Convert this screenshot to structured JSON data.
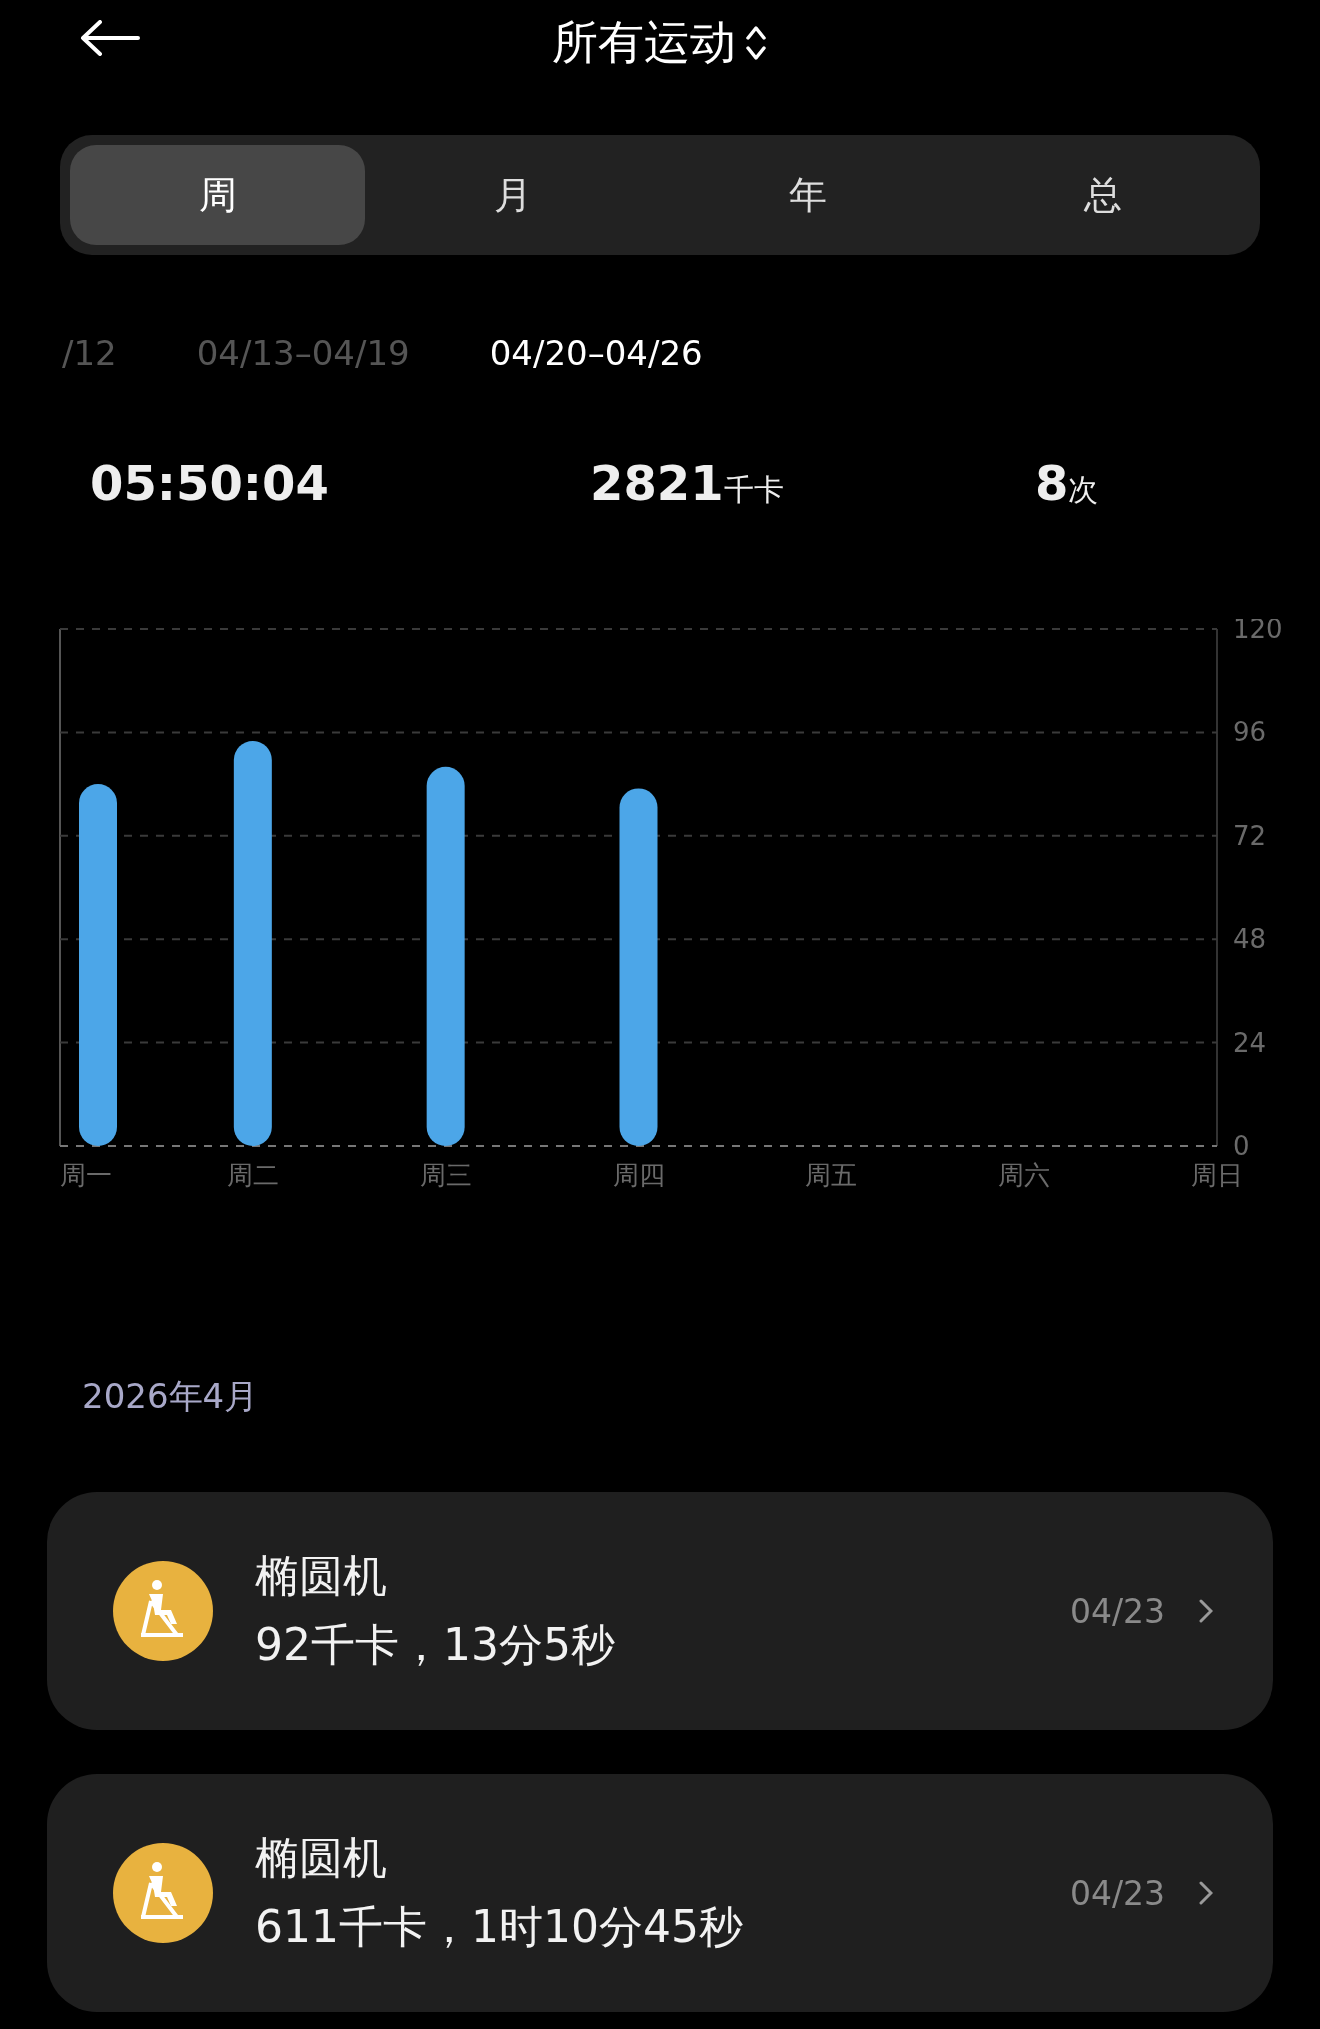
{
  "header": {
    "title": "所有运动"
  },
  "tabs": [
    {
      "label": "周",
      "selected": true
    },
    {
      "label": "月",
      "selected": false
    },
    {
      "label": "年",
      "selected": false
    },
    {
      "label": "总",
      "selected": false
    }
  ],
  "date_ranges": [
    {
      "label": "/12",
      "selected": false
    },
    {
      "label": "04/13–04/19",
      "selected": false
    },
    {
      "label": "04/20–04/26",
      "selected": true
    }
  ],
  "stats": [
    {
      "value": "05:50:04"
    },
    {
      "value": "2821",
      "unit": "千卡"
    },
    {
      "value": "8",
      "unit": "次"
    }
  ],
  "chart_data": {
    "type": "bar",
    "categories": [
      "周一",
      "周二",
      "周三",
      "周四",
      "周五",
      "周六",
      "周日"
    ],
    "values": [
      84,
      94,
      88,
      83,
      null,
      null,
      null
    ],
    "ylim": [
      0,
      120
    ],
    "yticks": [
      0,
      24,
      48,
      72,
      96,
      120
    ],
    "grid": true
  },
  "section_title": "2026年4月",
  "records": [
    {
      "name": "椭圆机",
      "detail": "92千卡，13分5秒",
      "date": "04/23"
    },
    {
      "name": "椭圆机",
      "detail": "611千卡，1时10分45秒",
      "date": "04/23"
    }
  ]
}
